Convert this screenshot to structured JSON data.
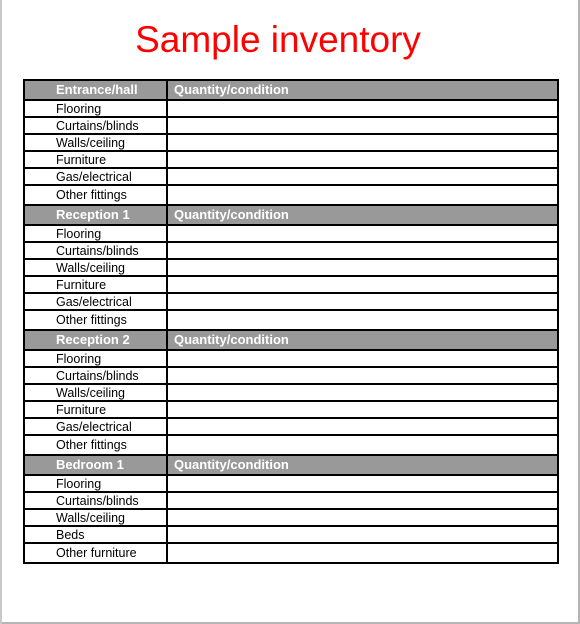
{
  "document": {
    "title": "Sample inventory",
    "title_color": "#ff0000",
    "header_color": "#999999"
  },
  "sections": [
    {
      "room": "Entrance/hall",
      "column_label": "Quantity/condition",
      "items": [
        "Flooring",
        "Curtains/blinds",
        "Walls/ceiling",
        "Furniture",
        "Gas/electrical",
        "Other fittings"
      ]
    },
    {
      "room": "Reception 1",
      "column_label": "Quantity/condition",
      "items": [
        "Flooring",
        "Curtains/blinds",
        "Walls/ceiling",
        "Furniture",
        "Gas/electrical",
        "Other fittings"
      ]
    },
    {
      "room": "Reception 2",
      "column_label": "Quantity/condition",
      "items": [
        "Flooring",
        "Curtains/blinds",
        "Walls/ceiling",
        "Furniture",
        "Gas/electrical",
        "Other fittings"
      ]
    },
    {
      "room": "Bedroom 1",
      "column_label": "Quantity/condition",
      "items": [
        "Flooring",
        "Curtains/blinds",
        "Walls/ceiling",
        "Beds",
        "Other furniture"
      ]
    }
  ]
}
